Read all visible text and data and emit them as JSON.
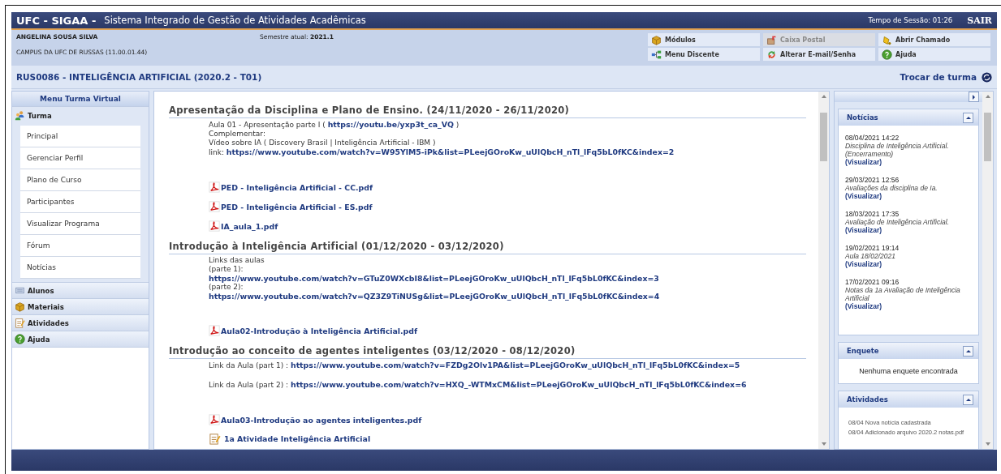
{
  "header": {
    "logo": "UFC - SIGAA -",
    "system": "Sistema Integrado de Gestão de Atividades Acadêmicas",
    "session": "Tempo de Sessão: 01:26",
    "logout": "SAIR"
  },
  "user": {
    "name": "ANGELINA SOUSA SILVA",
    "campus": "CAMPUS DA UFC DE RUSSAS (11.00.01.44)",
    "semester_label": "Semestre atual:",
    "semester": "2021.1"
  },
  "shortcuts": [
    {
      "label": "Módulos",
      "disabled": false
    },
    {
      "label": "Caixa Postal",
      "disabled": true
    },
    {
      "label": "Abrir Chamado",
      "disabled": false
    },
    {
      "label": "Menu Discente",
      "disabled": false
    },
    {
      "label": "Alterar E-mail/Senha",
      "disabled": false
    },
    {
      "label": "Ajuda",
      "disabled": false
    }
  ],
  "course": {
    "title": "RUS0086 - INTELIGÊNCIA ARTIFICIAL (2020.2 - T01)",
    "switch": "Trocar de turma"
  },
  "menu": {
    "title": "Menu Turma Virtual",
    "groups": [
      {
        "label": "Turma",
        "expanded": true,
        "children": [
          {
            "label": "Principal"
          },
          {
            "label": "Gerenciar Perfil"
          },
          {
            "label": "Plano de Curso"
          },
          {
            "label": "Participantes"
          },
          {
            "label": "Visualizar Programa"
          },
          {
            "label": "Fórum"
          },
          {
            "label": "Notícias"
          }
        ]
      },
      {
        "label": "Alunos",
        "expanded": false
      },
      {
        "label": "Materiais",
        "expanded": false
      },
      {
        "label": "Atividades",
        "expanded": false
      },
      {
        "label": "Ajuda",
        "expanded": false
      }
    ]
  },
  "sections": [
    {
      "title": "Apresentação da Disciplina e Plano de Ensino. (24/11/2020 - 26/11/2020)",
      "items": [
        {
          "kind": "link_line",
          "prefix": "Aula 01 - Apresentação parte I (",
          "link": "https://youtu.be/yxp3t_ca_VQ",
          "suffix": ")"
        },
        {
          "kind": "text",
          "text": "Complementar:"
        },
        {
          "kind": "text",
          "text": "Vídeo sobre IA ( Discovery Brasil | Inteligência Artificial - IBM )"
        },
        {
          "kind": "link_line",
          "prefix": "link:",
          "link": "https://www.youtube.com/watch?v=W95YlM5-iPk&list=PLeejGOroKw_uUlQbcH_nTl_lFq5bL0fKC&index=2"
        },
        {
          "kind": "file",
          "text": "PED - Inteligência Artificial - CC.pdf"
        },
        {
          "kind": "file",
          "text": "PED - Inteligência Artificial - ES.pdf"
        },
        {
          "kind": "file",
          "text": "IA_aula_1.pdf"
        }
      ]
    },
    {
      "title": "Introdução à Inteligência Artificial (01/12/2020 - 03/12/2020)",
      "items": [
        {
          "kind": "text",
          "text": "Links das aulas"
        },
        {
          "kind": "text",
          "text": "(parte 1):"
        },
        {
          "kind": "link",
          "text": "https://www.youtube.com/watch?v=GTuZ0WXcbI8&list=PLeejGOroKw_uUlQbcH_nTl_lFq5bL0fKC&index=3"
        },
        {
          "kind": "text",
          "text": "(parte 2):"
        },
        {
          "kind": "link",
          "text": "https://www.youtube.com/watch?v=QZ3Z9TiNUSg&list=PLeejGOroKw_uUlQbcH_nTl_lFq5bL0fKC&index=4"
        },
        {
          "kind": "file",
          "text": "Aula02-Introdução à Inteligência Artificial.pdf"
        }
      ]
    },
    {
      "title": "Introdução ao conceito de agentes inteligentes (03/12/2020 - 08/12/2020)",
      "items": [
        {
          "kind": "link_line",
          "prefix": "Link da Aula (part 1) :",
          "link": "https://www.youtube.com/watch?v=FZDg2Olv1PA&list=PLeejGOroKw_uUlQbcH_nTl_lFq5bL0fKC&index=5"
        },
        {
          "kind": "link_line",
          "prefix": "Link da Aula (part 2) :",
          "link": "https://www.youtube.com/watch?v=HXQ_-WTMxCM&list=PLeejGOroKw_uUlQbcH_nTl_lFq5bL0fKC&index=6"
        },
        {
          "kind": "file",
          "text": "Aula03-Introdução ao agentes inteligentes.pdf"
        },
        {
          "kind": "activity",
          "text": "1a Atividade Inteligência Artificial"
        }
      ]
    }
  ],
  "news": {
    "title": "Notícias",
    "items": [
      {
        "date": "08/04/2021 14:22",
        "title": "Disciplina de Inteligência Artificial. (Encerramento)",
        "link": "(Visualizar)"
      },
      {
        "date": "29/03/2021 12:56",
        "title": "Avaliações da disciplina de Ia.",
        "link": "(Visualizar)"
      },
      {
        "date": "18/03/2021 17:35",
        "title": "Avaliação de Inteligência Artificial.",
        "link": "(Visualizar)"
      },
      {
        "date": "19/02/2021 19:14",
        "title": "Aula 18/02/2021",
        "link": "(Visualizar)"
      },
      {
        "date": "17/02/2021 09:16",
        "title": "Notas da 1a Avaliação de Inteligência Artificial",
        "link": "(Visualizar)"
      }
    ]
  },
  "poll": {
    "title": "Enquete",
    "message": "Nenhuma enquete encontrada"
  },
  "activities": {
    "title": "Atividades",
    "items": [
      "08/04 Nova notícia cadastrada",
      "08/04 Adicionado arquivo 2020.2 notas.pdf"
    ]
  }
}
